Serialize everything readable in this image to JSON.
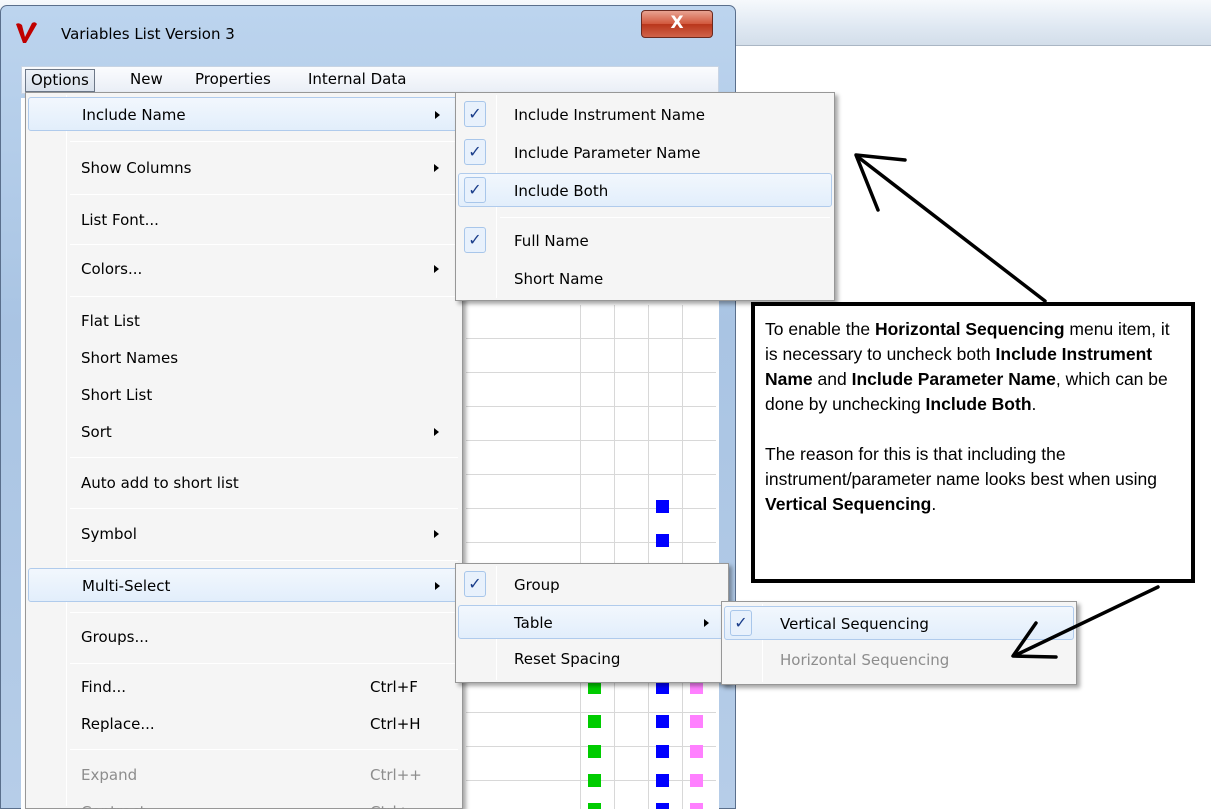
{
  "window": {
    "title": "Variables List Version 3",
    "close_label": "X"
  },
  "menubar": {
    "items": [
      "Options",
      "New",
      "Properties",
      "Internal Data"
    ]
  },
  "options_menu": {
    "items": [
      {
        "label": "Include Name",
        "submenu": true,
        "highlighted": true
      },
      {
        "label": "Show Columns",
        "submenu": true
      },
      {
        "label": "List Font...",
        "submenu": false
      },
      {
        "label": "Colors...",
        "submenu": true
      },
      {
        "label": "Flat List"
      },
      {
        "label": "Short Names"
      },
      {
        "label": "Short List"
      },
      {
        "label": "Sort",
        "submenu": true
      },
      {
        "label": "Auto add to short list"
      },
      {
        "label": "Symbol",
        "submenu": true
      },
      {
        "label": "Multi-Select",
        "submenu": true,
        "highlighted": true
      },
      {
        "label": "Groups..."
      },
      {
        "label": "Find...",
        "shortcut": "Ctrl+F"
      },
      {
        "label": "Replace...",
        "shortcut": "Ctrl+H"
      },
      {
        "label": "Expand",
        "shortcut": "Ctrl++",
        "disabled": true
      },
      {
        "label": "Contract",
        "shortcut": "Ctrl+-",
        "disabled": true
      }
    ]
  },
  "include_name_menu": {
    "items": [
      {
        "label": "Include Instrument Name",
        "checked": true
      },
      {
        "label": "Include Parameter Name",
        "checked": true
      },
      {
        "label": "Include Both",
        "checked": true,
        "highlighted": true
      },
      {
        "label": "Full Name",
        "checked": true
      },
      {
        "label": "Short Name",
        "checked": false
      }
    ]
  },
  "multi_select_menu": {
    "items": [
      {
        "label": "Group",
        "checked": true
      },
      {
        "label": "Table",
        "submenu": true,
        "highlighted": true
      },
      {
        "label": "Reset Spacing"
      }
    ]
  },
  "table_menu": {
    "items": [
      {
        "label": "Vertical Sequencing",
        "checked": true,
        "highlighted": true
      },
      {
        "label": "Horizontal Sequencing",
        "disabled": true
      }
    ]
  },
  "callout": {
    "p1_a": "To enable the ",
    "p1_b": "Horizontal Sequencing",
    "p1_c": " menu item, it is necessary to uncheck both ",
    "p1_d": "Include Instrument Name",
    "p1_e": " and ",
    "p1_f": "Include Parameter Name",
    "p1_g": ", which can be done by unchecking ",
    "p1_h": "Include Both",
    "p1_i": ".",
    "p2_a": "The reason for this is that including the instrument/parameter name looks best when using ",
    "p2_b": "Vertical Sequencing",
    "p2_c": "."
  },
  "colors": {
    "green": "#00cc00",
    "blue": "#0000ff",
    "pink": "#ff80ff",
    "check": "#1a3d8a"
  },
  "icons": {
    "logo": "v-logo-icon",
    "check": "checkmark-icon",
    "arrow": "submenu-arrow-icon"
  }
}
